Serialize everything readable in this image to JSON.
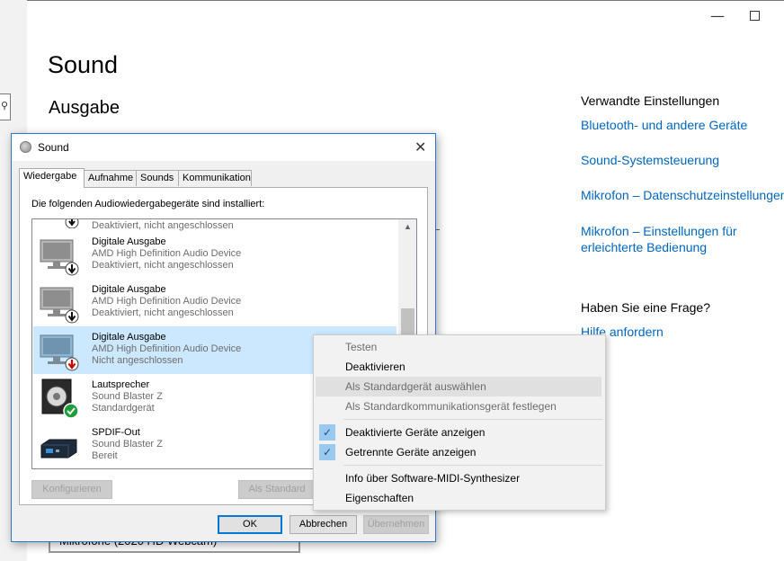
{
  "settings": {
    "page_title": "Sound",
    "section_title": "Ausgabe",
    "minimize_glyph": "—",
    "related_heading": "Verwandte Einstellungen",
    "links": [
      "Bluetooth- und andere Geräte",
      "Sound-Systemsteuerung",
      "Mikrofon – Datenschutzeinstellungen",
      "Mikrofon – Einstellungen für",
      "erleichterte Bedienung"
    ],
    "question_heading": "Haben Sie eine Frage?",
    "help_link": "Hilfe anfordern",
    "bottom_dropdown_partial": "Mikrofone (2020 HD Webcam)"
  },
  "dialog": {
    "title": "Sound",
    "close_glyph": "✕",
    "tabs": [
      "Wiedergabe",
      "Aufnahme",
      "Sounds",
      "Kommunikation"
    ],
    "caption": "Die folgenden Audiowiedergabegeräte sind installiert:",
    "partial_row_status": "Deaktiviert, nicht angeschlossen",
    "devices": [
      {
        "name": "Digitale Ausgabe",
        "sub": "AMD High Definition Audio Device",
        "status": "Deaktiviert, nicht angeschlossen",
        "icon": "monitor-disabled-icon"
      },
      {
        "name": "Digitale Ausgabe",
        "sub": "AMD High Definition Audio Device",
        "status": "Deaktiviert, nicht angeschlossen",
        "icon": "monitor-disabled-icon"
      },
      {
        "name": "Digitale Ausgabe",
        "sub": "AMD High Definition Audio Device",
        "status": "Nicht angeschlossen",
        "icon": "monitor-unplugged-icon"
      },
      {
        "name": "Lautsprecher",
        "sub": "Sound Blaster Z",
        "status": "Standardgerät",
        "icon": "speaker-default-icon"
      },
      {
        "name": "SPDIF-Out",
        "sub": "Sound Blaster Z",
        "status": "Bereit",
        "icon": "spdif-device-icon"
      }
    ],
    "buttons": {
      "configure": "Konfigurieren",
      "set_default": "Als Standard",
      "ok": "OK",
      "cancel": "Abbrechen",
      "apply": "Übernehmen"
    }
  },
  "context_menu": {
    "items": [
      {
        "label": "Testen",
        "disabled": true
      },
      {
        "label": "Deaktivieren",
        "disabled": false
      },
      {
        "label": "Als Standardgerät auswählen",
        "disabled": true
      },
      {
        "label": "Als Standardkommunikationsgerät festlegen",
        "disabled": true
      },
      {
        "label": "Deaktivierte Geräte anzeigen",
        "checked": true
      },
      {
        "label": "Getrennte Geräte anzeigen",
        "checked": true
      },
      {
        "label": "Info über Software-MIDI-Synthesizer",
        "disabled": false
      },
      {
        "label": "Eigenschaften",
        "disabled": false
      }
    ],
    "check_glyph": "✓"
  },
  "colors": {
    "link": "#0067c0",
    "selection": "#cce8ff",
    "accent": "#0078d7"
  }
}
